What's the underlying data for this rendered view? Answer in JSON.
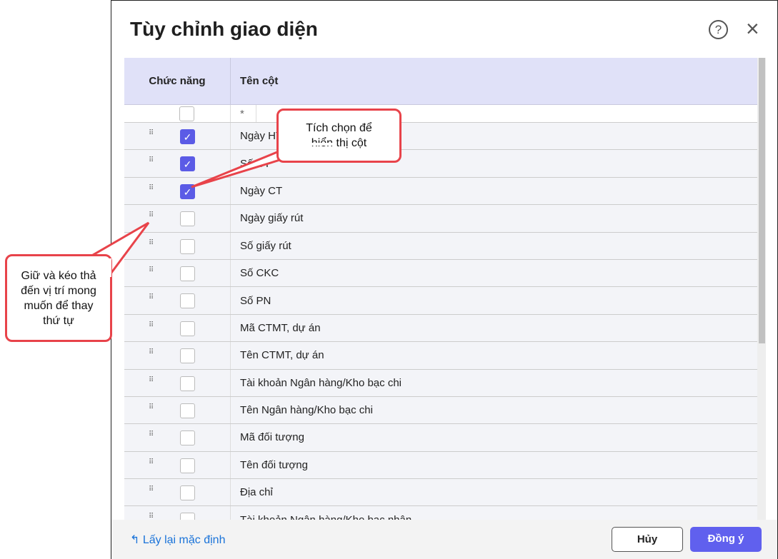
{
  "dialog": {
    "title": "Tùy chỉnh giao diện",
    "help_icon": "?",
    "close_icon": "×"
  },
  "table": {
    "headers": [
      "Chức năng",
      "Tên cột"
    ],
    "filter_placeholder": "*",
    "rows": [
      {
        "label": "Ngày HT",
        "checked": true
      },
      {
        "label": "Số CT",
        "checked": true
      },
      {
        "label": "Ngày CT",
        "checked": true
      },
      {
        "label": "Ngày giấy rút",
        "checked": false
      },
      {
        "label": "Số giấy rút",
        "checked": false
      },
      {
        "label": "Số CKC",
        "checked": false
      },
      {
        "label": "Số PN",
        "checked": false
      },
      {
        "label": "Mã CTMT, dự án",
        "checked": false
      },
      {
        "label": "Tên CTMT, dự án",
        "checked": false
      },
      {
        "label": "Tài khoản Ngân hàng/Kho bạc chi",
        "checked": false
      },
      {
        "label": "Tên Ngân hàng/Kho bạc chi",
        "checked": false
      },
      {
        "label": "Mã đối tượng",
        "checked": false
      },
      {
        "label": "Tên đối tượng",
        "checked": false
      },
      {
        "label": "Địa chỉ",
        "checked": false
      },
      {
        "label": "Tài khoản Ngân hàng/Kho bạc nhận",
        "checked": false
      }
    ]
  },
  "footer": {
    "reset": "Lấy lại mặc định",
    "cancel": "Hủy",
    "ok": "Đồng ý"
  },
  "callouts": {
    "check": "Tích chọn để hiển thị cột",
    "drag": "Giữ và kéo thả đến vị trí mong muốn để thay thứ tự"
  }
}
